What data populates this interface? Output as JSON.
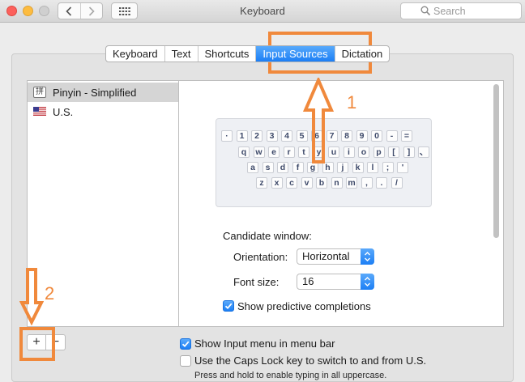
{
  "window": {
    "title": "Keyboard"
  },
  "search": {
    "placeholder": "Search"
  },
  "tabs": [
    "Keyboard",
    "Text",
    "Shortcuts",
    "Input Sources",
    "Dictation"
  ],
  "active_tab": "Input Sources",
  "sources": [
    {
      "label": "Pinyin - Simplified",
      "icon": "pinyin-icon",
      "icon_glyph": "拼",
      "selected": true
    },
    {
      "label": "U.S.",
      "icon": "us-flag-icon",
      "selected": false
    }
  ],
  "keyboard_rows": [
    [
      "·",
      "1",
      "2",
      "3",
      "4",
      "5",
      "6",
      "7",
      "8",
      "9",
      "0",
      "-",
      "="
    ],
    [
      "q",
      "w",
      "e",
      "r",
      "t",
      "y",
      "u",
      "i",
      "o",
      "p",
      "[",
      "]",
      "、"
    ],
    [
      "a",
      "s",
      "d",
      "f",
      "g",
      "h",
      "j",
      "k",
      "l",
      ";",
      "'"
    ],
    [
      "z",
      "x",
      "c",
      "v",
      "b",
      "n",
      "m",
      ",",
      ".",
      "/"
    ]
  ],
  "candidate": {
    "heading": "Candidate window:",
    "orientation_label": "Orientation:",
    "orientation_value": "Horizontal",
    "font_size_label": "Font size:",
    "font_size_value": "16",
    "predictive_label": "Show predictive completions",
    "predictive_checked": true
  },
  "bottom": {
    "show_input_menu_label": "Show Input menu in menu bar",
    "show_input_menu_checked": true,
    "caps_lock_label": "Use the Caps Lock key to switch to and from U.S.",
    "caps_lock_checked": false,
    "caps_lock_hint": "Press and hold to enable typing in all uppercase."
  },
  "controls": {
    "add": "+",
    "remove": "−"
  },
  "annotations": {
    "step1": "1",
    "step2": "2",
    "color": "#f0893c"
  },
  "colors": {
    "accent": "#1c7ff5",
    "annotation": "#f0893c"
  }
}
